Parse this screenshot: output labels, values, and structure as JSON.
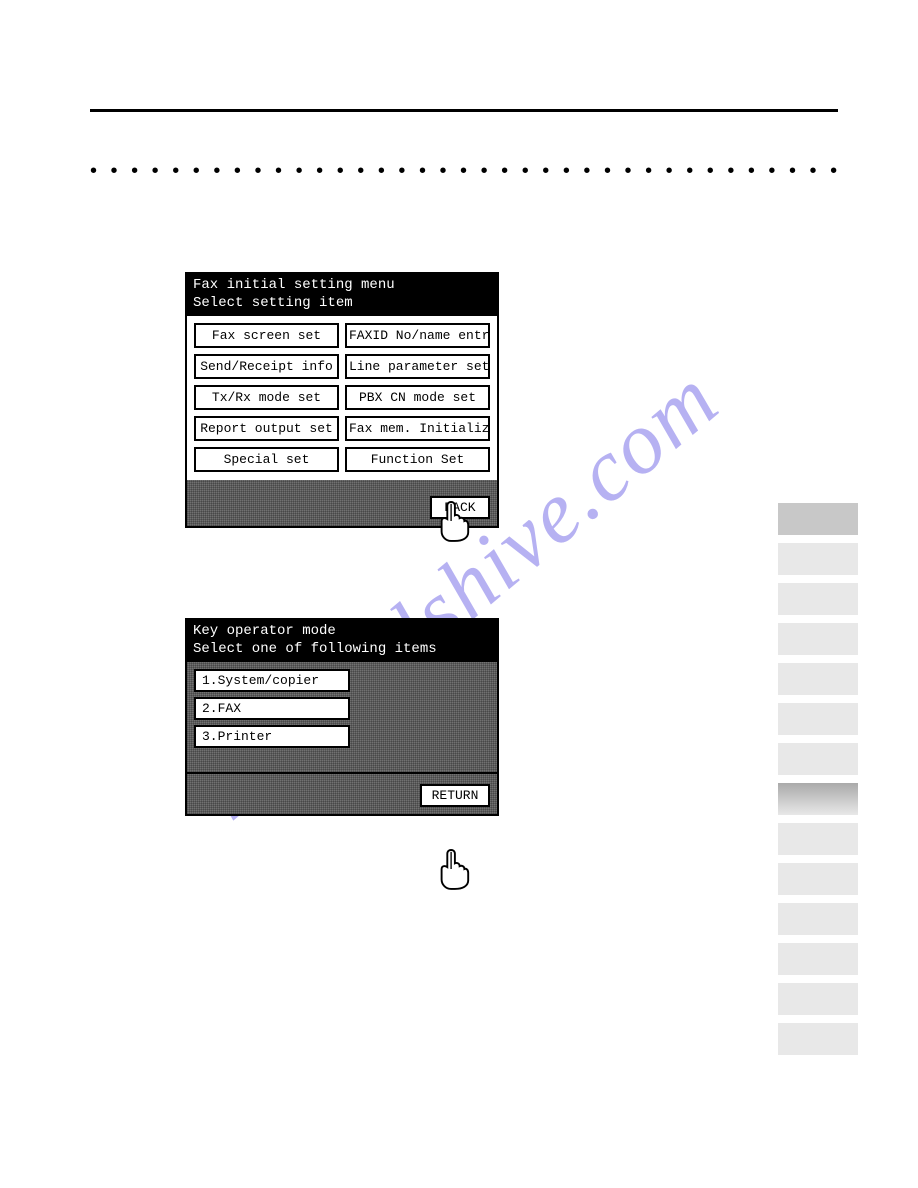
{
  "watermark": "manualshive.com",
  "panel1": {
    "title_line1": "Fax initial setting menu",
    "title_line2": "Select setting item",
    "buttons": {
      "r1c1": "Fax screen set",
      "r1c2": "FAXID No/name entry",
      "r2c1": "Send/Receipt info",
      "r2c2": "Line parameter set",
      "r3c1": "Tx/Rx mode set",
      "r3c2": "PBX CN mode set",
      "r4c1": "Report output set",
      "r4c2": "Fax mem. Initialize",
      "r5c1": "Special set",
      "r5c2": "Function Set"
    },
    "back_label": "BACK"
  },
  "panel2": {
    "title_line1": "Key operator mode",
    "title_line2": "Select one of following items",
    "items": {
      "i1": "1.System/copier",
      "i2": "2.FAX",
      "i3": "3.Printer"
    },
    "return_label": "RETURN"
  }
}
